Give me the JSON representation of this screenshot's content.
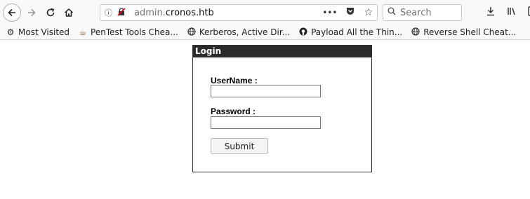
{
  "browser": {
    "url_prefix": "admin.",
    "url_domain": "cronos.htb",
    "search_placeholder": "Search",
    "url_actions": [
      "•••",
      "pocket-icon",
      "bookmark-star-icon"
    ]
  },
  "bookmarks": [
    {
      "icon": "gear-icon",
      "label": "Most Visited"
    },
    {
      "icon": "cup-icon",
      "label": "PenTest Tools Chea..."
    },
    {
      "icon": "globe-icon",
      "label": "Kerberos, Active Dir..."
    },
    {
      "icon": "github-icon",
      "label": "Payload All the Thin..."
    },
    {
      "icon": "globe-icon",
      "label": "Reverse Shell Cheat..."
    }
  ],
  "login": {
    "title": "Login",
    "username_label": "UserName :",
    "username_value": "",
    "password_label": "Password :",
    "password_value": "",
    "submit_label": "Submit"
  }
}
